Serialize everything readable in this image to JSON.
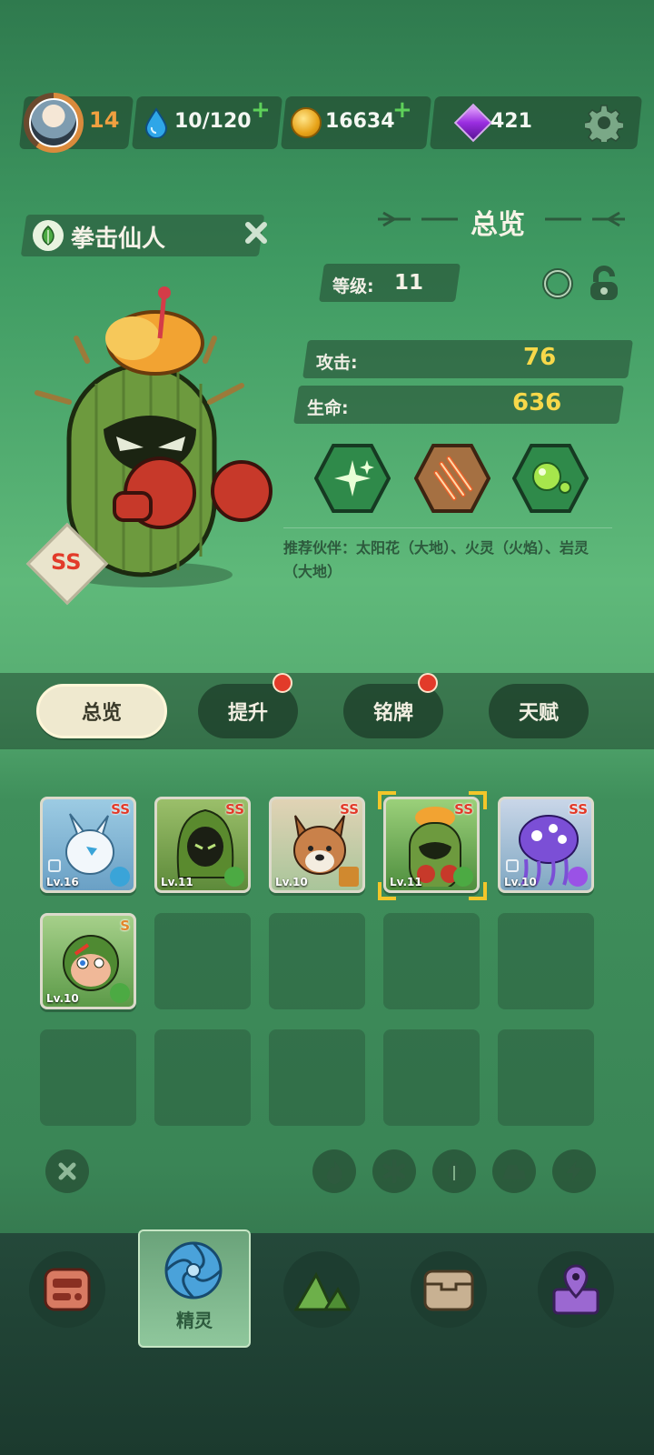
{
  "topbar": {
    "player_level": "14",
    "energy": "10/120",
    "coins": "16634",
    "gems": "421",
    "plus": "+"
  },
  "pet": {
    "name": "拳击仙人",
    "grade": "SS",
    "element_icon": "leaf-icon"
  },
  "overview": {
    "title": "总览",
    "level_label": "等级:",
    "level_value": "11",
    "attack_label": "攻击:",
    "attack_value": "76",
    "hp_label": "生命:",
    "hp_value": "636",
    "skills": [
      "sparkle-skill-icon",
      "claw-skill-icon",
      "bubble-skill-icon"
    ],
    "partners_text": "推荐伙伴：太阳花（大地）、火灵（火焰）、岩灵（大地）"
  },
  "tabs": [
    {
      "label": "总览",
      "active": true,
      "badge": false
    },
    {
      "label": "提升",
      "active": false,
      "badge": true
    },
    {
      "label": "铭牌",
      "active": false,
      "badge": true
    },
    {
      "label": "天赋",
      "active": false,
      "badge": false
    }
  ],
  "roster": [
    {
      "grade": "SS",
      "level": "Lv.16",
      "element": "ice",
      "locked": true,
      "selected": false
    },
    {
      "grade": "SS",
      "level": "Lv.11",
      "element": "leaf",
      "locked": false,
      "selected": false
    },
    {
      "grade": "SS",
      "level": "Lv.10",
      "element": "earth",
      "locked": false,
      "selected": false
    },
    {
      "grade": "SS",
      "level": "Lv.11",
      "element": "leaf",
      "locked": false,
      "selected": true
    },
    {
      "grade": "SS",
      "level": "Lv.10",
      "element": "thunder",
      "locked": true,
      "selected": false
    },
    {
      "grade": "S",
      "level": "Lv.10",
      "element": "leaf",
      "locked": false,
      "selected": false
    }
  ],
  "filters": [
    "clear-filter-icon",
    "fire-filter-icon",
    "ice-filter-icon",
    "leaf-filter-icon",
    "earth-filter-icon",
    "thunder-filter-icon"
  ],
  "bottom_nav": {
    "items": [
      "device-icon",
      "spirit-icon",
      "mountain-icon",
      "chest-icon",
      "map-pin-icon"
    ],
    "active_label": "精灵"
  },
  "colors": {
    "accent_yellow": "#f7d84a",
    "grade_red": "#e23b2a",
    "plus_green": "#5ed15a"
  }
}
